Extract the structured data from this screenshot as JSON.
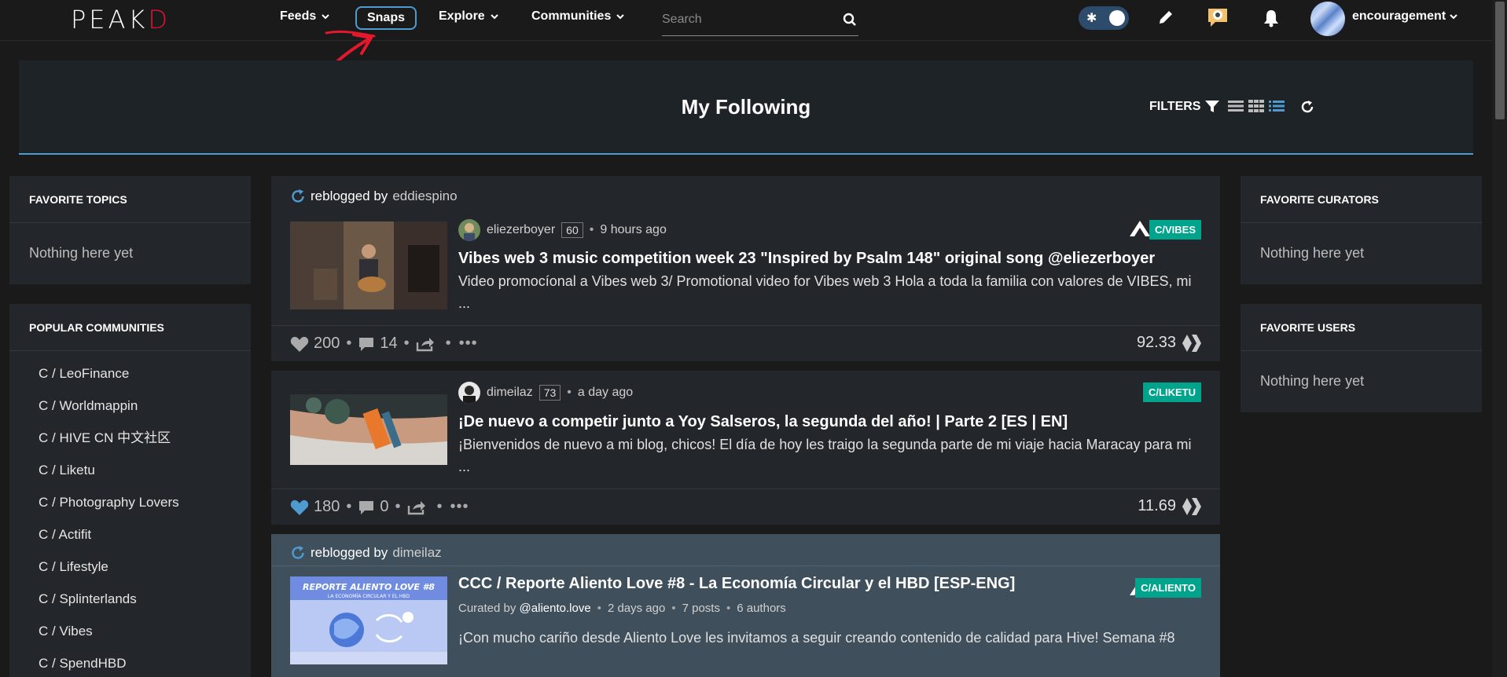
{
  "nav": {
    "logo_main": "PEAK",
    "logo_accent": "D",
    "feeds": "Feeds",
    "snaps": "Snaps",
    "explore": "Explore",
    "communities": "Communities",
    "search_placeholder": "Search",
    "username": "encouragement"
  },
  "header": {
    "title": "My Following",
    "filters": "FILTERS"
  },
  "left": {
    "favorite_topics_title": "FAVORITE TOPICS",
    "favorite_topics_empty": "Nothing here yet",
    "popular_title": "POPULAR COMMUNITIES",
    "communities": [
      "C / LeoFinance",
      "C / Worldmappin",
      "C / HIVE CN 中文社区",
      "C / Liketu",
      "C / Photography Lovers",
      "C / Actifit",
      "C / Lifestyle",
      "C / Splinterlands",
      "C / Vibes",
      "C / SpendHBD"
    ]
  },
  "right": {
    "curators_title": "FAVORITE CURATORS",
    "curators_empty": "Nothing here yet",
    "users_title": "FAVORITE USERS",
    "users_empty": "Nothing here yet"
  },
  "posts": [
    {
      "reblog_label": "reblogged by",
      "reblogger": "eddiespino",
      "author": "eliezerboyer",
      "rep": "60",
      "time": "9 hours ago",
      "community": "C/VIBES",
      "title": "Vibes web 3 music competition week 23 \"Inspired by Psalm 148\" original song @eliezerboyer",
      "body": "Video promocíonal a Vibes web 3/ Promotional video for Vibes web 3 Hola a toda la familia con valores de VIBES, mi ...",
      "likes": "200",
      "comments": "14",
      "payout": "92.33"
    },
    {
      "author": "dimeilaz",
      "rep": "73",
      "time": "a day ago",
      "community": "C/LIKETU",
      "title": "¡De nuevo a competir junto a Yoy Salseros, la segunda del año! | Parte 2 [ES | EN]",
      "body": "¡Bienvenidos de nuevo a mi blog, chicos! El día de hoy les traigo la segunda parte de mi viaje hacia Maracay para mi ...",
      "likes": "180",
      "comments": "0",
      "payout": "11.69"
    },
    {
      "reblog_label": "reblogged by",
      "reblogger": "dimeilaz",
      "community": "C/ALIENTO",
      "title": "CCC / Reporte Aliento Love #8 - La Economía Circular y el HBD [ESP-ENG]",
      "curated_by": "Curated by",
      "curator": "@aliento.love",
      "time": "2 days ago",
      "posts": "7 posts",
      "authors": "6 authors",
      "body": "¡Con mucho cariño desde Aliento Love les invitamos a seguir creando contenido de calidad para Hive! Semana #8",
      "thumb_line1": "REPORTE ALIENTO LOVE #8",
      "thumb_line2": "LA ECONOMÍA CIRCULAR Y EL HBD"
    }
  ],
  "colors": {
    "accent": "#4e9bd1",
    "community_badge": "#00a38c",
    "logo_red": "#e31337",
    "highlight_card": "#3f4f5c"
  }
}
